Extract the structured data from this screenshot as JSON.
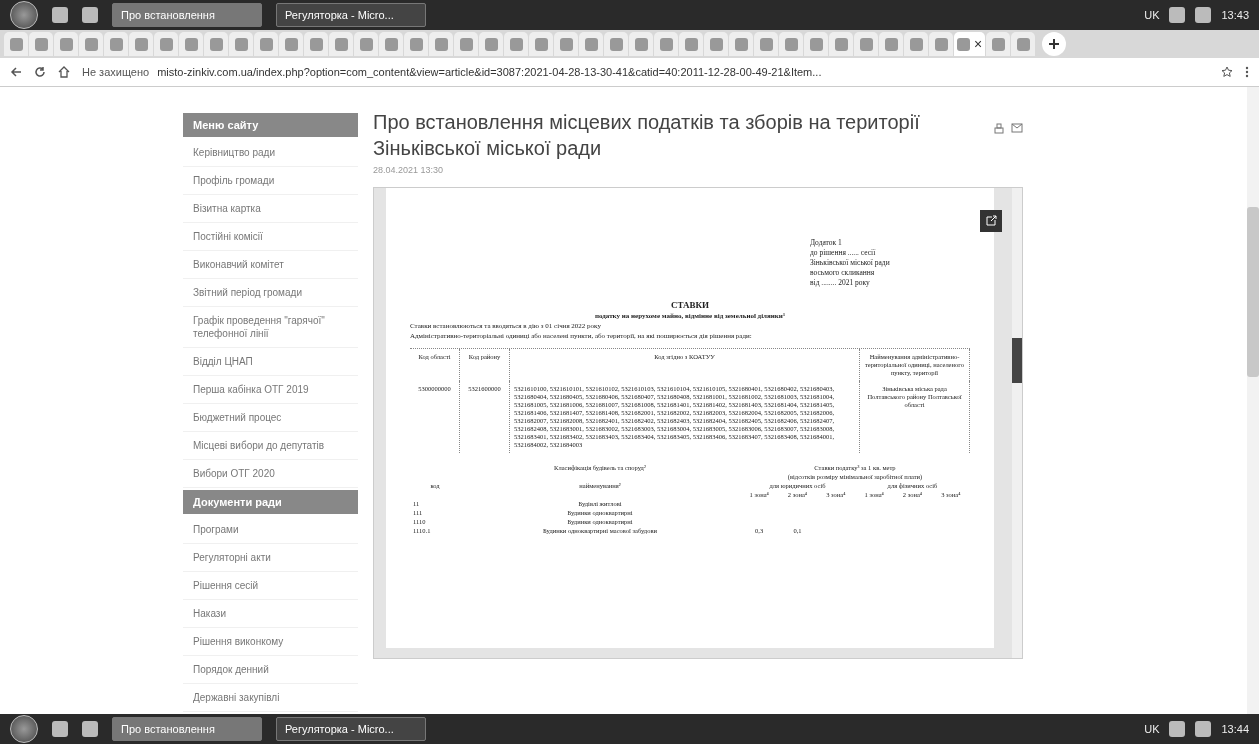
{
  "taskbars": [
    {
      "windows": [
        {
          "label": "Про встановлення",
          "selected": true
        },
        {
          "label": "Регуляторка - Micro...",
          "selected": false
        }
      ],
      "language": "UK",
      "time": "13:43"
    },
    {
      "windows": [
        {
          "label": "Про встановлення",
          "selected": true
        },
        {
          "label": "Регуляторка - Micro...",
          "selected": false
        }
      ],
      "language": "UK",
      "time": "13:44"
    }
  ],
  "tabs": [
    {
      "selected": false
    },
    {
      "selected": false
    },
    {
      "selected": false
    },
    {
      "selected": false
    },
    {
      "selected": false
    },
    {
      "selected": false
    },
    {
      "selected": false
    },
    {
      "selected": false
    },
    {
      "selected": false
    },
    {
      "selected": false
    },
    {
      "selected": false
    },
    {
      "selected": false
    },
    {
      "selected": false
    },
    {
      "selected": false
    },
    {
      "selected": false
    },
    {
      "selected": false
    },
    {
      "selected": false
    },
    {
      "selected": false
    },
    {
      "selected": false
    },
    {
      "selected": false
    },
    {
      "selected": false
    },
    {
      "selected": false
    },
    {
      "selected": false
    },
    {
      "selected": false
    },
    {
      "selected": false
    },
    {
      "selected": false
    },
    {
      "selected": false
    },
    {
      "selected": false
    },
    {
      "selected": false
    },
    {
      "selected": false
    },
    {
      "selected": false
    },
    {
      "selected": false
    },
    {
      "selected": false
    },
    {
      "selected": false
    },
    {
      "selected": false
    },
    {
      "selected": false
    },
    {
      "selected": false
    },
    {
      "selected": false
    },
    {
      "selected": true
    },
    {
      "selected": false
    },
    {
      "selected": false
    }
  ],
  "tab_close": "×",
  "address": {
    "security": "Не захищено",
    "url": "misto-zinkiv.com.ua/index.php?option=com_content&view=article&id=3087:2021-04-28-13-30-41&catid=40:2011-12-28-00-49-21&Item..."
  },
  "sidebar": [
    {
      "heading": "Меню сайту",
      "items": [
        "Керівництво ради",
        "Профіль громади",
        "Візитна картка",
        "Постійні комісії",
        "Виконавчий комітет",
        "Звітний період громади",
        "Графік проведення \"гарячої\" телефонної лінії",
        "Відділ ЦНАП",
        "Перша кабінка ОТГ 2019",
        "Бюджетний процес",
        "Місцеві вибори до депутатів",
        "Вибори ОТГ 2020"
      ]
    },
    {
      "heading": "Документи ради",
      "items": [
        "Програми",
        "Регуляторні акти",
        "Рішення сесій",
        "Накази",
        "Рішення виконкому",
        "Порядок денний",
        "Державні закупівлі"
      ]
    }
  ],
  "article": {
    "title": "Про встановлення місцевих податків та зборів на території Зіньківської міської ради",
    "date": "28.04.2021 13:30",
    "document": {
      "annex": [
        "Додаток 1",
        "до рішення ...... сесії",
        "Зіньківської міської ради",
        "восьмого скликання",
        "від ........ 2021 року"
      ],
      "heading": "СТАВКИ",
      "subheading": "податку на нерухоме майно, відмінне від земельної ділянки¹",
      "intro": [
        "Ставки встановлюються та вводяться в дію з 01 січня 2022 року",
        "Адміністративно-територіальні одиниці або населені пункти, або території, на які поширюється дія рішення ради:"
      ],
      "columns": [
        "Код області",
        "Код району",
        "Код згідно з КОАТУУ",
        "Найменування адміністративно-територіальної одиниці, населеного пункту, території"
      ],
      "row": {
        "region": "5300000000",
        "district": "5321600000",
        "codes": "5321610100, 5321610101, 5321610102, 5321610103, 5321610104, 5321610105, 5321680401, 5321680402, 5321680403, 5321680404, 5321680405, 5321680406, 5321680407, 5321680408, 5321681001, 5321681002, 5321681003, 5321681004, 5321681005, 5321681006, 5321681007, 5321681008, 5321681401, 5321681402, 5321681403, 5321681404, 5321681405, 5321681406, 5321681407, 5321681408, 5321682001, 5321682002, 5321682003, 5321682004, 5321682005, 5321682006, 5321682007, 5321682008, 5321682401, 5321682402, 5321682403, 5321682404, 5321682405, 5321682406, 5321682407, 5321682408, 5321683001, 5321683002, 5321683003, 5321683004, 5321683005, 5321683006, 5321683007, 5321683008, 5321683401, 5321683402, 5321683403, 5321683404, 5321683405, 5321683406, 5321683407, 5321683408, 5321684001, 5321684002, 5321684003",
        "name": "Зіньківська міська рада Полтавського району Полтавської області"
      },
      "class_heading": "Класифікація будівель та споруд²",
      "rate_heading": "Ставки податку³ за 1 кв. метр",
      "rate_note": "(відсотків розміру мінімальної заробітної плати)",
      "rate_groups": [
        "для юридичних осіб",
        "для фізичних осіб"
      ],
      "zones": [
        "1 зона⁴",
        "2 зона⁴",
        "3 зона⁴",
        "1 зона⁴",
        "2 зона⁴",
        "3 зона⁴"
      ],
      "class_columns": [
        "код",
        "найменування²"
      ],
      "classes": [
        {
          "code": "11",
          "name": "Будівлі житлові"
        },
        {
          "code": "111",
          "name": "Будинки одноквартирні"
        },
        {
          "code": "1110",
          "name": "Будинки одноквартирні"
        },
        {
          "code": "1110.1",
          "name": "Будинки одноквартирні масової забудови",
          "rates": [
            "0,3",
            "0,1"
          ]
        }
      ]
    }
  }
}
